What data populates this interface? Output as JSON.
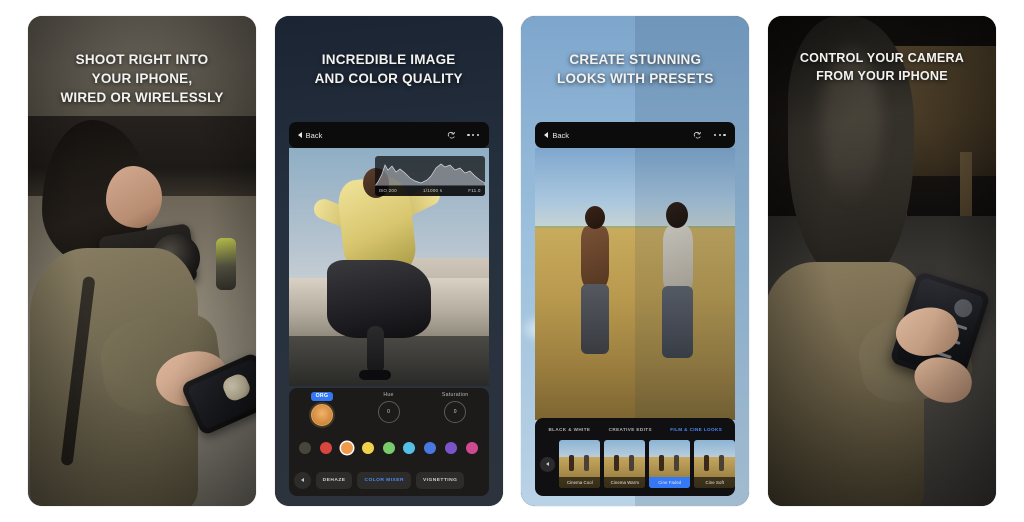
{
  "gallery": {
    "panels": [
      {
        "id": "shoot-into-iphone",
        "headline": [
          "SHOOT RIGHT INTO",
          "YOUR IPHONE,",
          "WIRED OR WIRELESSLY"
        ]
      },
      {
        "id": "image-color-quality",
        "headline": [
          "INCREDIBLE IMAGE",
          "AND COLOR QUALITY"
        ]
      },
      {
        "id": "presets",
        "headline": [
          "CREATE STUNNING",
          "LOOKS WITH PRESETS"
        ]
      },
      {
        "id": "control-camera",
        "headline": [
          "CONTROL YOUR CAMERA",
          "FROM YOUR IPHONE"
        ]
      }
    ]
  },
  "navbar": {
    "back_label": "Back",
    "undo_icon": "undo-arrow-icon",
    "more_icon": "more-dots-icon",
    "back_icon": "chevron-left-icon"
  },
  "editor": {
    "histogram": {
      "iso": "ISO 200",
      "shutter": "1/1000 s",
      "aperture": "F11.0"
    },
    "dials": [
      {
        "label": "ORG",
        "value": "",
        "selected": true
      },
      {
        "label": "Hue",
        "value": "0",
        "selected": false
      },
      {
        "label": "Saturation",
        "value": "0",
        "selected": false
      }
    ],
    "swatches": [
      {
        "name": "neutral",
        "color": "#4a453c",
        "selected": false
      },
      {
        "name": "red",
        "color": "#d9453f",
        "selected": false
      },
      {
        "name": "orange",
        "color": "#ef9a4d",
        "selected": true
      },
      {
        "name": "yellow",
        "color": "#f0d14b",
        "selected": false
      },
      {
        "name": "green",
        "color": "#79cc6d",
        "selected": false
      },
      {
        "name": "aqua",
        "color": "#54c0e8",
        "selected": false
      },
      {
        "name": "blue",
        "color": "#4a78e0",
        "selected": false
      },
      {
        "name": "purple",
        "color": "#7a54c8",
        "selected": false
      },
      {
        "name": "magenta",
        "color": "#cf4a8e",
        "selected": false
      }
    ],
    "tabs": [
      {
        "label": "DEHAZE",
        "selected": false
      },
      {
        "label": "COLOR MIXER",
        "selected": true
      },
      {
        "label": "VIGNETTING",
        "selected": false
      }
    ],
    "prev_icon": "chevron-left-icon"
  },
  "presets": {
    "categories": [
      {
        "label": "BLACK & WHITE",
        "selected": false
      },
      {
        "label": "CREATIVE EDITS",
        "selected": false
      },
      {
        "label": "FILM & CINE LOOKS",
        "selected": true
      }
    ],
    "items": [
      {
        "label": "Cinema Cool",
        "selected": false
      },
      {
        "label": "Cinema Warm",
        "selected": false
      },
      {
        "label": "Cine Faded",
        "selected": true
      },
      {
        "label": "Cine Soft",
        "selected": false
      }
    ],
    "prev_icon": "chevron-left-icon"
  },
  "colors": {
    "accent_blue": "#3478f6",
    "tab_blue": "#4b8cf7",
    "panel_dark": "#101012",
    "page_bg": "#ffffff"
  }
}
